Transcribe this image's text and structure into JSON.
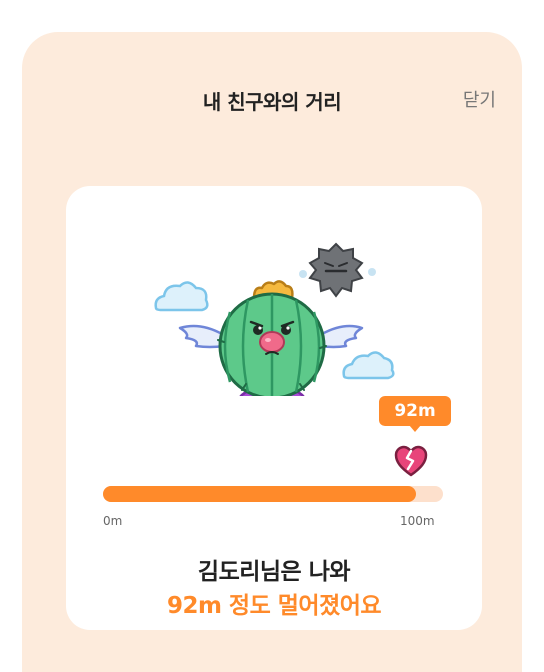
{
  "header": {
    "title": "내 친구와의 거리",
    "close_label": "닫기"
  },
  "distance": {
    "value_label": "92m",
    "progress": 0.92,
    "min_label": "0m",
    "max_label": "100m"
  },
  "message": {
    "line1": "김도리님은 나와",
    "line2": "92m 정도 멀어졌어요"
  },
  "illustration": {
    "character": "cactus-character",
    "icons": [
      "cloud-icon",
      "cloud-icon",
      "angry-cloud-icon",
      "broken-heart-icon"
    ]
  },
  "colors": {
    "accent": "#FF8A2A",
    "sheet_bg": "#FDEBDC",
    "track_bg": "#FDE0CC",
    "heart": "#E8457A"
  }
}
